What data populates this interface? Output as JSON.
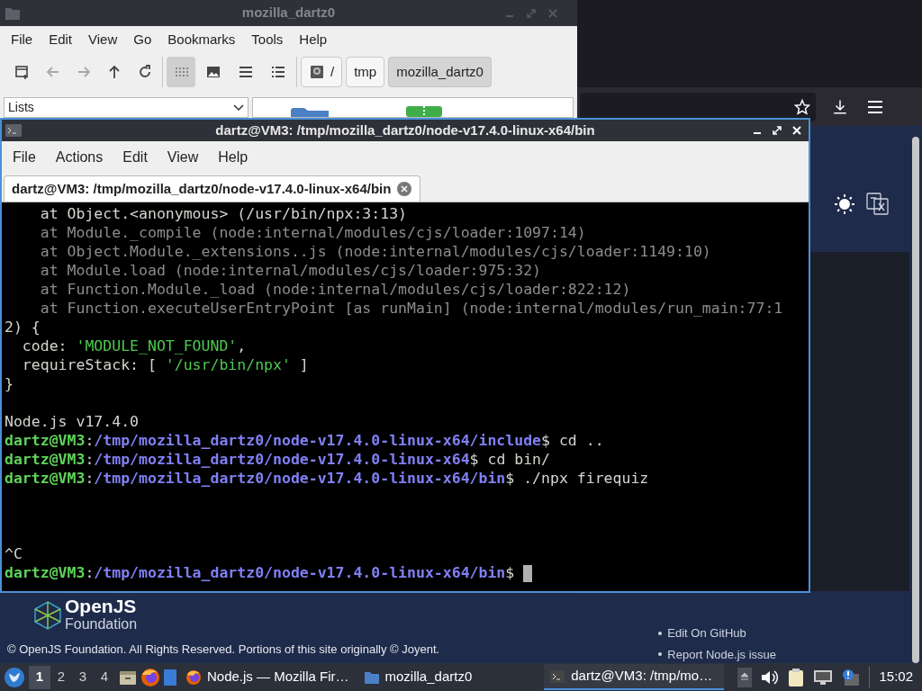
{
  "file_manager": {
    "title": "mozilla_dartz0",
    "menu": [
      "File",
      "Edit",
      "View",
      "Go",
      "Bookmarks",
      "Tools",
      "Help"
    ],
    "nav_buttons": [
      {
        "kind": "new-tab",
        "disabled": false
      },
      {
        "kind": "back",
        "disabled": true
      },
      {
        "kind": "forward",
        "disabled": true
      },
      {
        "kind": "up",
        "disabled": false
      },
      {
        "kind": "reload",
        "disabled": false
      }
    ],
    "view_buttons": [
      {
        "kind": "icons",
        "selected": true
      },
      {
        "kind": "thumbnails",
        "selected": false
      },
      {
        "kind": "compact",
        "selected": false
      },
      {
        "kind": "detailed",
        "selected": false
      }
    ],
    "path": [
      {
        "kind": "root",
        "label": "/",
        "selected": false
      },
      {
        "kind": "dir",
        "label": "tmp",
        "selected": false
      },
      {
        "kind": "dir",
        "label": "mozilla_dartz0",
        "selected": true
      }
    ],
    "side_pane": {
      "value": "Lists"
    }
  },
  "browser": {
    "footer": {
      "logo_name": "OpenJS",
      "logo_sub": "Foundation",
      "copyright": "© OpenJS Foundation. All Rights Reserved. Portions of this site originally © Joyent.",
      "links": [
        "Edit On GitHub",
        "Report Node.js issue"
      ]
    }
  },
  "terminal": {
    "title": "dartz@VM3: /tmp/mozilla_dartz0/node-v17.4.0-linux-x64/bin",
    "menu": [
      "File",
      "Actions",
      "Edit",
      "View",
      "Help"
    ],
    "tabs": [
      {
        "label": "dartz@VM3: /tmp/mozilla_dartz0/node-v17.4.0-linux-x64/bin",
        "selected": true
      }
    ],
    "lines": [
      {
        "segments": [
          {
            "kind": "plain",
            "text": "    at Object.<anonymous> (/usr/bin/npx:3:13)"
          }
        ]
      },
      {
        "segments": [
          {
            "kind": "dim",
            "text": "    at Module._compile (node:internal/modules/cjs/loader:1097:14)"
          }
        ]
      },
      {
        "segments": [
          {
            "kind": "dim",
            "text": "    at Object.Module._extensions..js (node:internal/modules/cjs/loader:1149:10)"
          }
        ]
      },
      {
        "segments": [
          {
            "kind": "dim",
            "text": "    at Module.load (node:internal/modules/cjs/loader:975:32)"
          }
        ]
      },
      {
        "segments": [
          {
            "kind": "dim",
            "text": "    at Function.Module._load (node:internal/modules/cjs/loader:822:12)"
          }
        ]
      },
      {
        "segments": [
          {
            "kind": "dim",
            "text": "    at Function.executeUserEntryPoint [as runMain] (node:internal/modules/run_main:77:1"
          }
        ]
      },
      {
        "segments": [
          {
            "kind": "plain",
            "text": "2) {"
          }
        ]
      },
      {
        "segments": [
          {
            "kind": "plain",
            "text": "  code: "
          },
          {
            "kind": "string",
            "text": "'MODULE_NOT_FOUND'"
          },
          {
            "kind": "plain",
            "text": ","
          }
        ]
      },
      {
        "segments": [
          {
            "kind": "plain",
            "text": "  requireStack: [ "
          },
          {
            "kind": "string",
            "text": "'/usr/bin/npx'"
          },
          {
            "kind": "plain",
            "text": " ]"
          }
        ]
      },
      {
        "segments": [
          {
            "kind": "plain",
            "text": "}"
          }
        ]
      },
      {
        "kind": "blank"
      },
      {
        "segments": [
          {
            "kind": "plain",
            "text": "Node.js v17.4.0"
          }
        ]
      },
      {
        "segments": [
          {
            "kind": "user",
            "text": "dartz@VM3"
          },
          {
            "kind": "plain",
            "text": ":"
          },
          {
            "kind": "path",
            "text": "/tmp/mozilla_dartz0/node-v17.4.0-linux-x64/include"
          },
          {
            "kind": "plain",
            "text": "$ cd .."
          }
        ]
      },
      {
        "segments": [
          {
            "kind": "user",
            "text": "dartz@VM3"
          },
          {
            "kind": "plain",
            "text": ":"
          },
          {
            "kind": "path",
            "text": "/tmp/mozilla_dartz0/node-v17.4.0-linux-x64"
          },
          {
            "kind": "plain",
            "text": "$ cd bin/"
          }
        ]
      },
      {
        "segments": [
          {
            "kind": "user",
            "text": "dartz@VM3"
          },
          {
            "kind": "plain",
            "text": ":"
          },
          {
            "kind": "path",
            "text": "/tmp/mozilla_dartz0/node-v17.4.0-linux-x64/bin"
          },
          {
            "kind": "plain",
            "text": "$ ./npx firequiz"
          }
        ]
      },
      {
        "kind": "blank"
      },
      {
        "kind": "blank"
      },
      {
        "kind": "blank"
      },
      {
        "segments": [
          {
            "kind": "plain",
            "text": "^C"
          }
        ]
      },
      {
        "segments": [
          {
            "kind": "user",
            "text": "dartz@VM3"
          },
          {
            "kind": "plain",
            "text": ":"
          },
          {
            "kind": "path",
            "text": "/tmp/mozilla_dartz0/node-v17.4.0-linux-x64/bin"
          },
          {
            "kind": "plain",
            "text": "$ "
          },
          {
            "kind": "cursor"
          }
        ]
      }
    ]
  },
  "taskbar": {
    "workspaces": [
      {
        "label": "1",
        "selected": true
      },
      {
        "label": "2",
        "selected": false
      },
      {
        "label": "3",
        "selected": false
      },
      {
        "label": "4",
        "selected": false
      }
    ],
    "tasks": [
      {
        "kind": "browser",
        "label": "Node.js — Mozilla Fir…",
        "selected": false
      },
      {
        "kind": "folder",
        "label": "mozilla_dartz0",
        "selected": false
      },
      {
        "kind": "terminal",
        "label": "dartz@VM3: /tmp/mo…",
        "selected": true
      }
    ],
    "clock": "15:02"
  }
}
